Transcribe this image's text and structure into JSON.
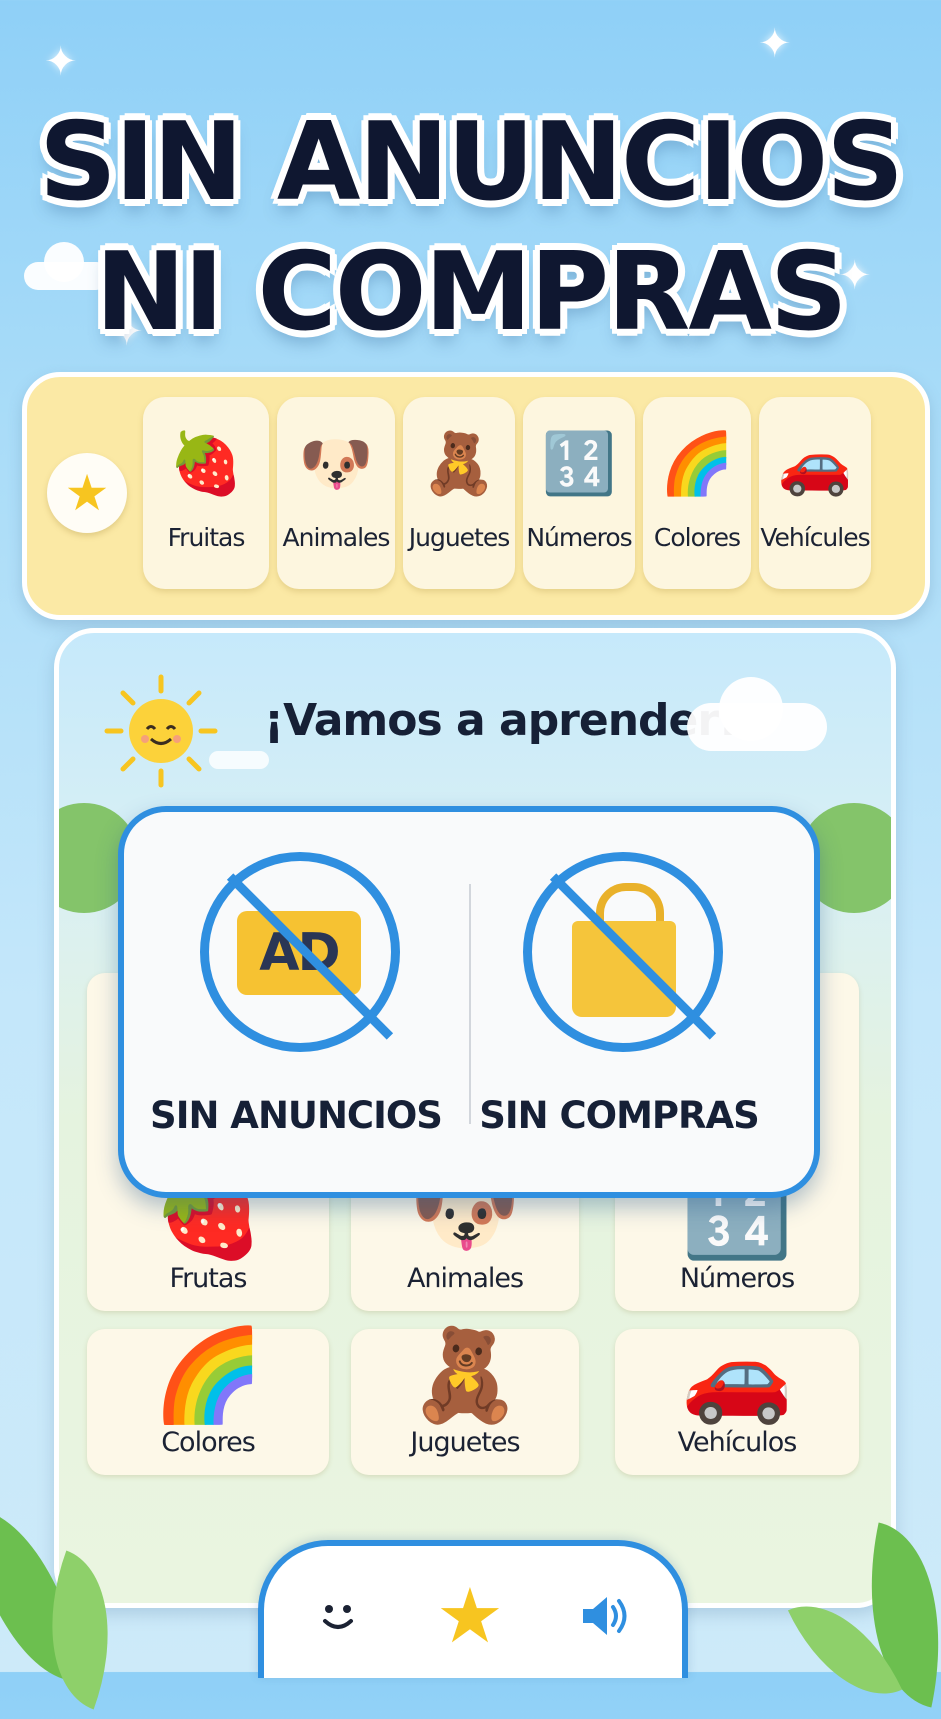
{
  "headline": {
    "line1": "SIN ANUNCIOS",
    "line2": "NI COMPRAS"
  },
  "category_bar": {
    "favorites_icon": "star-icon",
    "items": [
      {
        "label": "Fruitas",
        "icon": "strawberry-icon",
        "glyph": "🍓"
      },
      {
        "label": "Animales",
        "icon": "dog-icon",
        "glyph": "🐶"
      },
      {
        "label": "Juguetes",
        "icon": "teddy-bear-icon",
        "glyph": "🧸"
      },
      {
        "label": "Números",
        "icon": "numbers-icon",
        "glyph": "🔢"
      },
      {
        "label": "Colores",
        "icon": "rainbow-icon",
        "glyph": "🌈"
      },
      {
        "label": "Vehícules",
        "icon": "car-icon",
        "glyph": "🚗"
      }
    ]
  },
  "main": {
    "title": "¡Vamos a aprender!",
    "grid": [
      {
        "label": "Frutas",
        "icon": "strawberry-icon",
        "glyph": "🍓"
      },
      {
        "label": "Animales",
        "icon": "dog-icon",
        "glyph": "🐶"
      },
      {
        "label": "Números",
        "icon": "numbers-icon",
        "glyph": "🔢"
      },
      {
        "label": "Colores",
        "icon": "rainbow-icon",
        "glyph": "🌈"
      },
      {
        "label": "Juguetes",
        "icon": "teddy-bear-icon",
        "glyph": "🧸"
      },
      {
        "label": "Vehículos",
        "icon": "car-icon",
        "glyph": "🚗"
      }
    ]
  },
  "popup": {
    "no_ads_label": "SIN ANUNCIOS",
    "no_purchases_label": "SIN COMPRAS",
    "ad_badge_text": "AD"
  },
  "bottom_bar": {
    "buttons": [
      {
        "icon": "smiley-icon"
      },
      {
        "icon": "star-icon"
      },
      {
        "icon": "speaker-icon"
      }
    ]
  },
  "colors": {
    "accent_blue": "#2f8fe0",
    "bar_yellow": "#fbe9a5",
    "star_yellow": "#f7c520",
    "text_dark": "#162036"
  }
}
